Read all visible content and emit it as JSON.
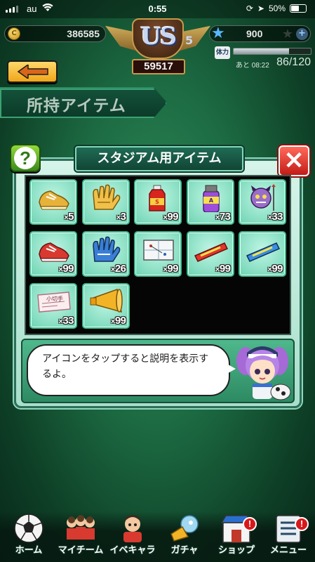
{
  "status_bar": {
    "carrier": "au",
    "time": "0:55",
    "battery": "50%"
  },
  "hud": {
    "coins": "386585",
    "stars": "900",
    "rank_label": "US",
    "rank_small": "5",
    "score": "59517",
    "stamina_time": "あと 08:22",
    "stamina_count": "86/120",
    "stamina_fraction": 0.72,
    "stamina_icon_label": "体力"
  },
  "header": {
    "back_label": "back",
    "title": "所持アイテム"
  },
  "dialog": {
    "title": "スタジアム用アイテム",
    "help_label": "?",
    "close_label": "✕",
    "items": [
      {
        "name": "gold-spikes",
        "qty": "5"
      },
      {
        "name": "gold-gloves",
        "qty": "3"
      },
      {
        "name": "red-drink",
        "qty": "99"
      },
      {
        "name": "purple-spray",
        "qty": "73"
      },
      {
        "name": "devil-mascot",
        "qty": "33"
      },
      {
        "name": "red-spikes",
        "qty": "99"
      },
      {
        "name": "blue-gloves",
        "qty": "26"
      },
      {
        "name": "tactics-board",
        "qty": "99"
      },
      {
        "name": "red-gum",
        "qty": "99"
      },
      {
        "name": "blue-gum",
        "qty": "99"
      },
      {
        "name": "check-ticket",
        "qty": "33",
        "icon_text": "小切手"
      },
      {
        "name": "megaphone",
        "qty": "99"
      }
    ],
    "qty_prefix": "×",
    "message": "アイコンをタップすると説明を表示するよ。"
  },
  "bottom_nav": [
    {
      "label": "ホーム",
      "icon": "soccer-ball-icon",
      "badge": ""
    },
    {
      "label": "マイチーム",
      "icon": "team-icon",
      "badge": ""
    },
    {
      "label": "イベキャラ",
      "icon": "event-character-icon",
      "badge": ""
    },
    {
      "label": "ガチャ",
      "icon": "gacha-icon",
      "badge": ""
    },
    {
      "label": "ショップ",
      "icon": "shop-icon",
      "badge": "!"
    },
    {
      "label": "メニュー",
      "icon": "menu-icon",
      "badge": "!"
    }
  ],
  "colors": {
    "accent_green": "#3ab88c",
    "close_red": "#c31b17",
    "back_orange": "#f0a619"
  }
}
